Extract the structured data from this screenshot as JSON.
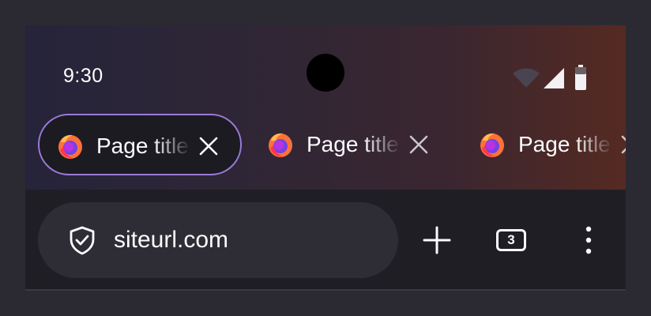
{
  "status_bar": {
    "time": "9:30",
    "icons": [
      "wifi-icon",
      "cell-signal-icon",
      "battery-icon"
    ]
  },
  "tabs": [
    {
      "title": "Page title",
      "favicon": "firefox-icon",
      "selected": true
    },
    {
      "title": "Page title",
      "favicon": "firefox-icon",
      "selected": false
    },
    {
      "title": "Page title",
      "favicon": "firefox-icon",
      "selected": false
    }
  ],
  "toolbar": {
    "url": "siteurl.com",
    "tab_count": "3",
    "icons": [
      "shield-icon",
      "plus-icon",
      "tab-counter-icon",
      "kebab-menu-icon"
    ]
  },
  "colors": {
    "selected_tab_border": "#9a7ad7",
    "toolbar_background": "#1f1e25",
    "urlbar_background": "#2e2d35",
    "text": "#fbfbfe"
  }
}
